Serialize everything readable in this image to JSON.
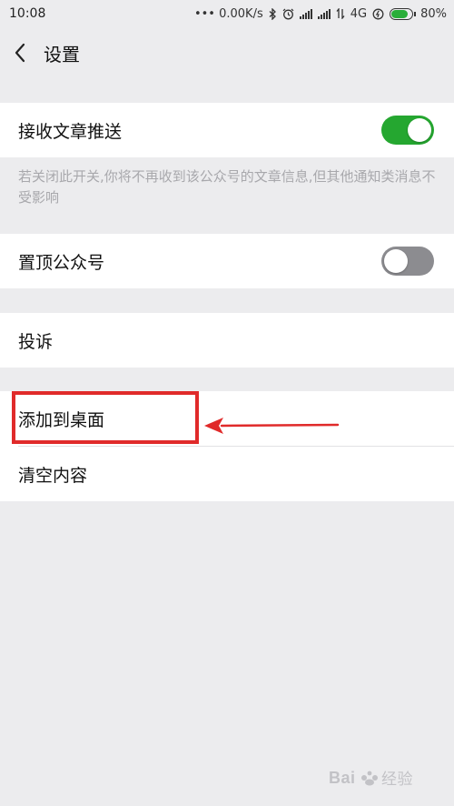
{
  "status_bar": {
    "time": "10:08",
    "network_speed": "••• 0.00K/s",
    "network_type": "4G",
    "battery_percent": "80%",
    "battery_level": 0.8
  },
  "nav": {
    "title": "设置"
  },
  "settings": {
    "push": {
      "label": "接收文章推送",
      "enabled": true
    },
    "push_note": "若关闭此开关,你将不再收到该公众号的文章信息,但其他通知类消息不受影响",
    "pin": {
      "label": "置顶公众号",
      "enabled": false
    },
    "complaint": {
      "label": "投诉"
    },
    "add_desktop": {
      "label": "添加到桌面"
    },
    "clear": {
      "label": "清空内容"
    }
  },
  "colors": {
    "toggle_on": "#25a730",
    "toggle_off": "#8c8c90",
    "annotation": "#e02a2a",
    "page_bg": "#ececee"
  },
  "watermark": {
    "text": "Bai\u0000经验"
  }
}
